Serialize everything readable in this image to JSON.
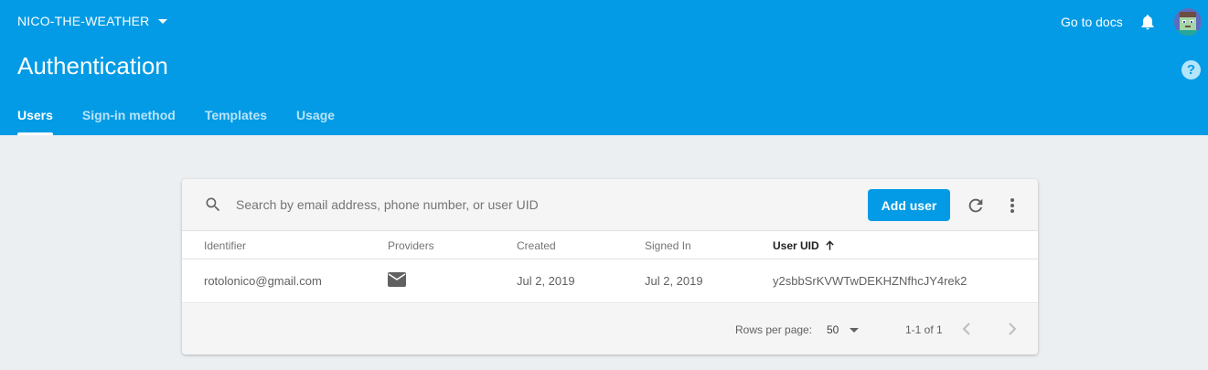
{
  "header": {
    "project_name": "NICO-THE-WEATHER",
    "docs_link": "Go to docs",
    "page_title": "Authentication",
    "help_symbol": "?",
    "bg_color": "#039be5"
  },
  "tabs": [
    {
      "label": "Users",
      "active": true
    },
    {
      "label": "Sign-in method",
      "active": false
    },
    {
      "label": "Templates",
      "active": false
    },
    {
      "label": "Usage",
      "active": false
    }
  ],
  "toolbar": {
    "search_placeholder": "Search by email address, phone number, or user UID",
    "add_user_label": "Add user"
  },
  "table": {
    "columns": [
      "Identifier",
      "Providers",
      "Created",
      "Signed In",
      "User UID"
    ],
    "sorted_column": "User UID",
    "sort_direction": "ascending",
    "rows": [
      {
        "identifier": "rotolonico@gmail.com",
        "provider_icon": "mail-icon",
        "created": "Jul 2, 2019",
        "signed_in": "Jul 2, 2019",
        "uid": "y2sbbSrKVWTwDEKHZNfhcJY4rek2"
      }
    ]
  },
  "pagination": {
    "rows_per_page_label": "Rows per page:",
    "rows_per_page_value": "50",
    "range_label": "1-1 of 1"
  }
}
